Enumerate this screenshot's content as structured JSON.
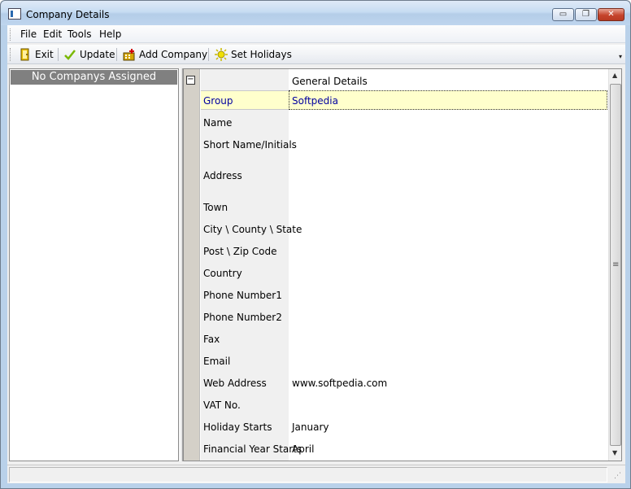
{
  "window": {
    "title": "Company Details",
    "buttons": {
      "minimize": "▭",
      "maximize": "❐",
      "close": "✕"
    }
  },
  "menu": {
    "items": [
      "File",
      "Edit",
      "Tools",
      "Help"
    ]
  },
  "toolbar": {
    "exit_label": "Exit",
    "update_label": "Update",
    "add_company_label": "Add Company",
    "set_holidays_label": "Set Holidays",
    "overflow": "▾"
  },
  "left_pane": {
    "header": "No Companys Assigned"
  },
  "grid": {
    "collapse_symbol": "−",
    "section_title": "General Details",
    "rows": [
      {
        "label": "Group",
        "value": "Softpedia"
      },
      {
        "label": "Name",
        "value": ""
      },
      {
        "label": "Short Name/Initials",
        "value": ""
      },
      {
        "label": "Address",
        "value": ""
      },
      {
        "label": "Town",
        "value": ""
      },
      {
        "label": "City \\ County \\ State",
        "value": ""
      },
      {
        "label": "Post \\ Zip Code",
        "value": ""
      },
      {
        "label": "Country",
        "value": ""
      },
      {
        "label": "Phone Number1",
        "value": ""
      },
      {
        "label": "Phone Number2",
        "value": ""
      },
      {
        "label": "Fax",
        "value": ""
      },
      {
        "label": "Email",
        "value": ""
      },
      {
        "label": "Web Address",
        "value": "www.softpedia.com"
      },
      {
        "label": "VAT No.",
        "value": ""
      },
      {
        "label": "Holiday Starts",
        "value": "January"
      },
      {
        "label": "Financial Year Starts",
        "value": "April"
      }
    ],
    "scroll_up": "▲",
    "scroll_down": "▼"
  },
  "statusbar": {
    "text": "",
    "grip": "⋰"
  },
  "colors": {
    "selected_row_bg": "#ffffcc",
    "selected_text": "#0000a0",
    "left_header_bg": "#808080"
  }
}
